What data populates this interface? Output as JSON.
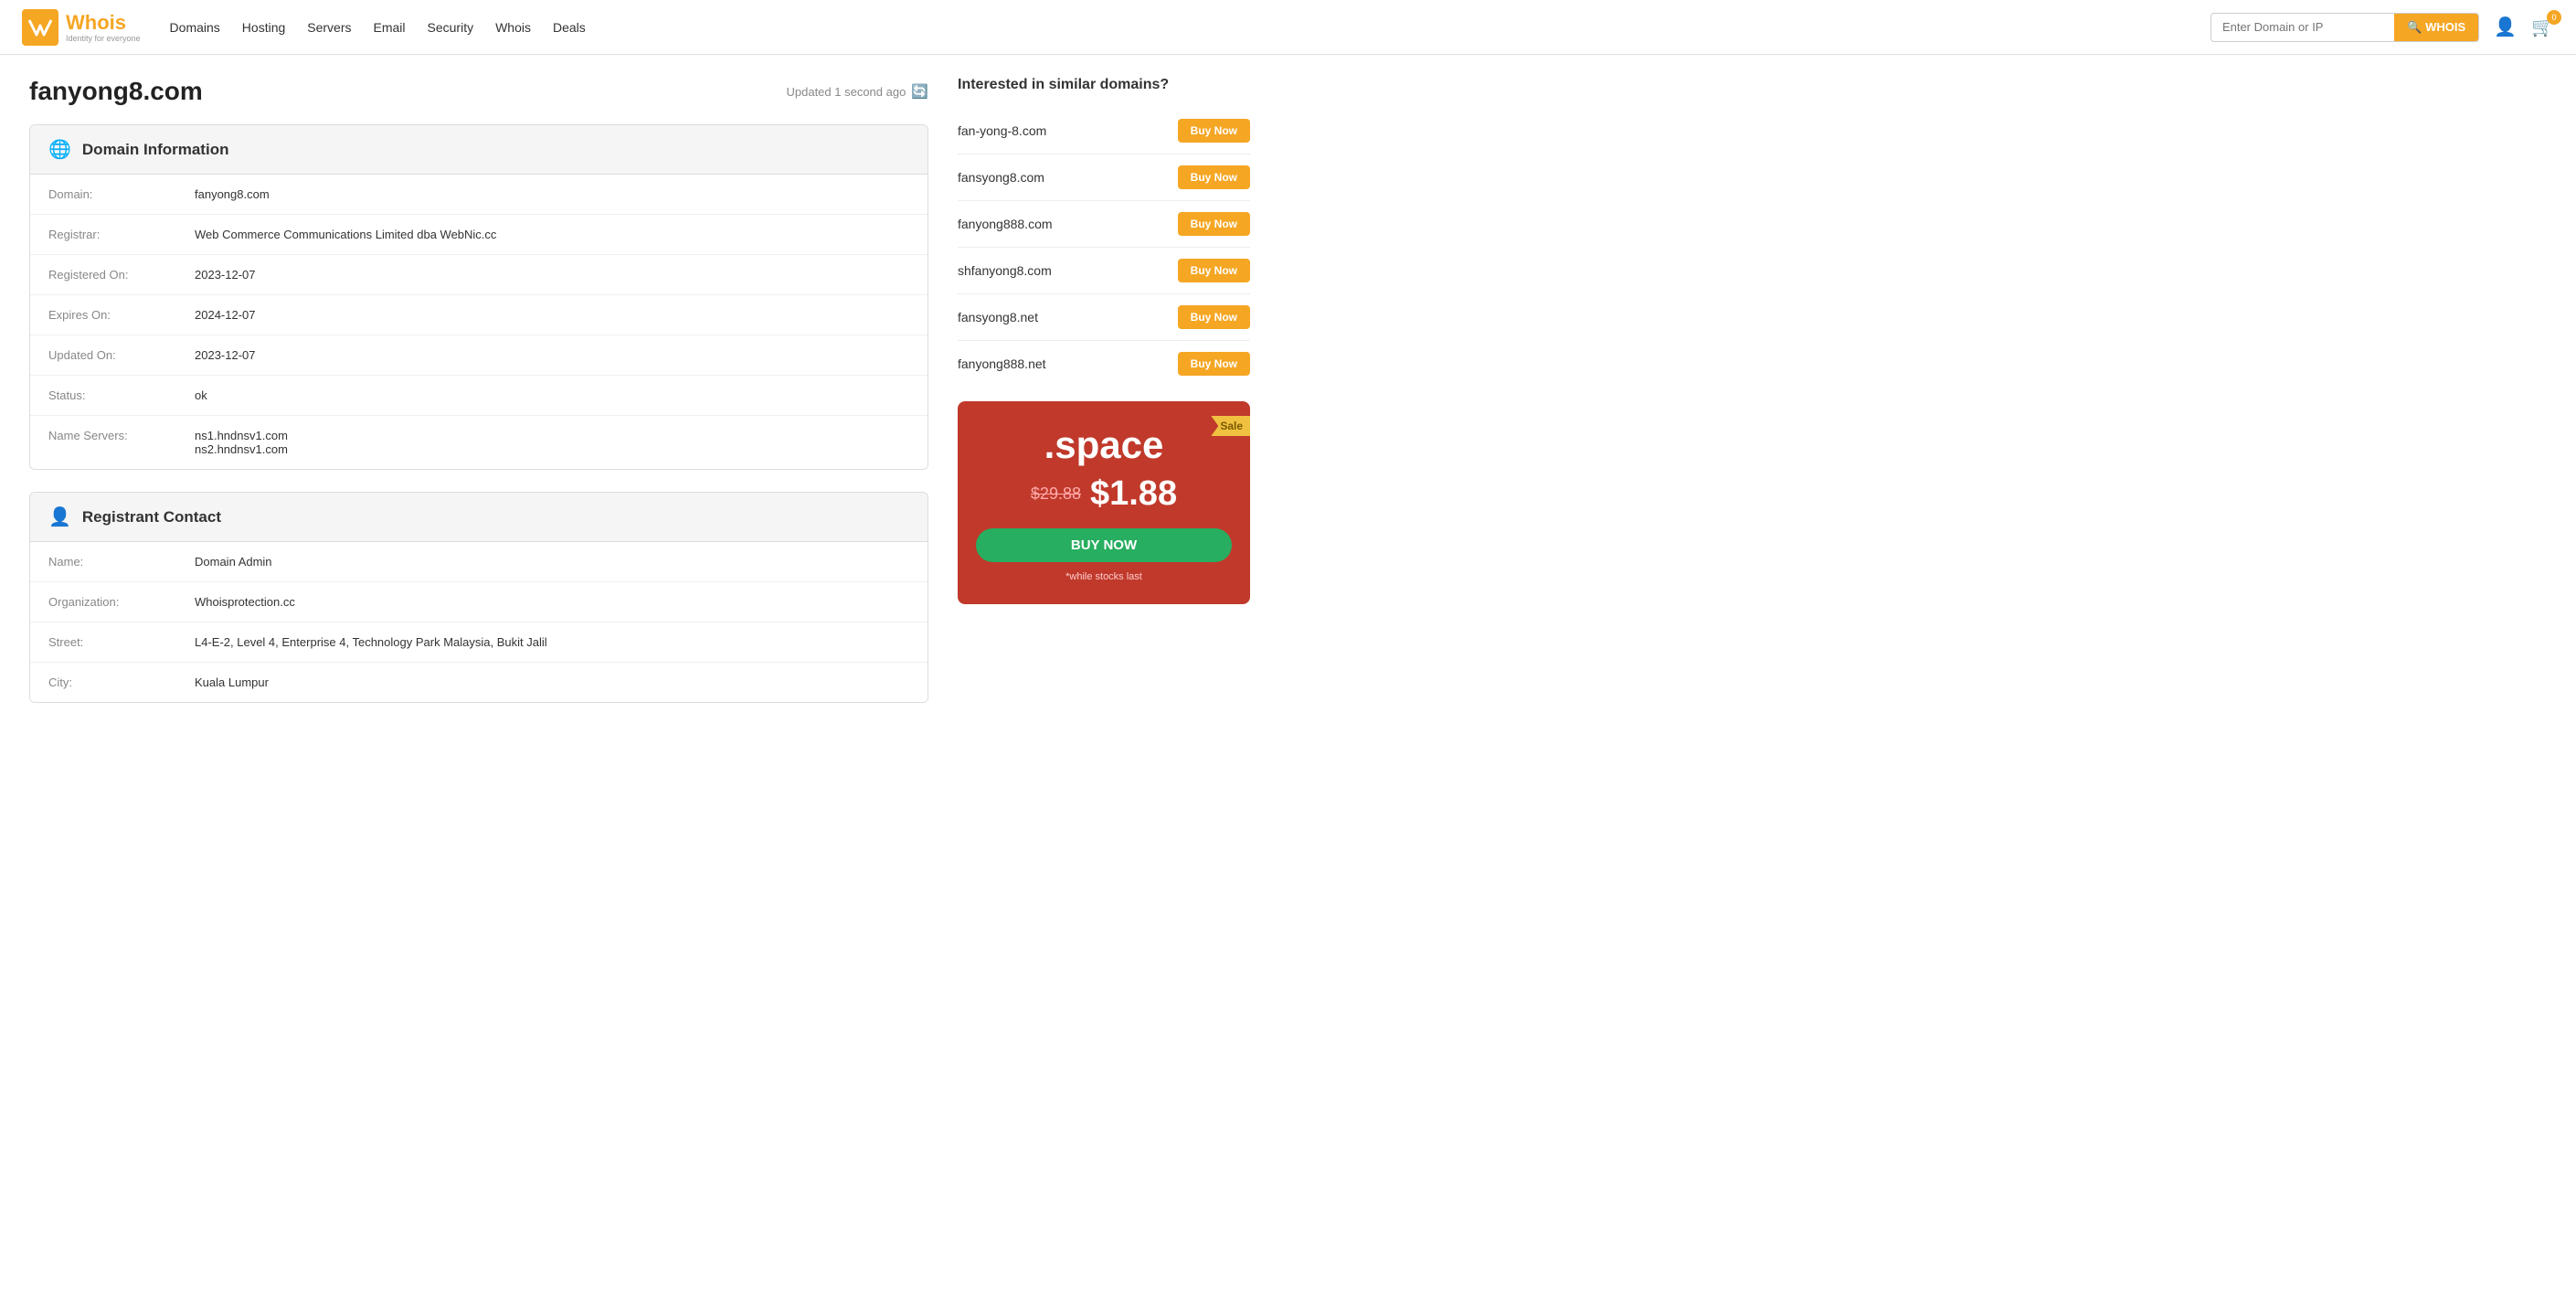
{
  "brand": {
    "name": "Whois",
    "tagline": "Identity for everyone"
  },
  "nav": {
    "links": [
      "Domains",
      "Hosting",
      "Servers",
      "Email",
      "Security",
      "Whois",
      "Deals"
    ],
    "search_placeholder": "Enter Domain or IP",
    "search_btn_label": "WHOIS"
  },
  "cart": {
    "count": "0"
  },
  "page": {
    "domain": "fanyong8.com",
    "updated_label": "Updated 1 second ago"
  },
  "domain_info": {
    "section_title": "Domain Information",
    "fields": [
      {
        "label": "Domain:",
        "value": "fanyong8.com"
      },
      {
        "label": "Registrar:",
        "value": "Web Commerce Communications Limited dba WebNic.cc"
      },
      {
        "label": "Registered On:",
        "value": "2023-12-07"
      },
      {
        "label": "Expires On:",
        "value": "2024-12-07"
      },
      {
        "label": "Updated On:",
        "value": "2023-12-07"
      },
      {
        "label": "Status:",
        "value": "ok"
      },
      {
        "label": "Name Servers:",
        "value": "ns1.hndnsv1.com\nns2.hndnsv1.com"
      }
    ]
  },
  "registrant": {
    "section_title": "Registrant Contact",
    "fields": [
      {
        "label": "Name:",
        "value": "Domain Admin"
      },
      {
        "label": "Organization:",
        "value": "Whoisprotection.cc"
      },
      {
        "label": "Street:",
        "value": "L4-E-2, Level 4, Enterprise 4, Technology Park Malaysia, Bukit Jalil"
      },
      {
        "label": "City:",
        "value": "Kuala Lumpur"
      }
    ]
  },
  "sidebar": {
    "similar_heading": "Interested in similar domains?",
    "domains": [
      {
        "name": "fan-yong-8.com"
      },
      {
        "name": "fansyong8.com"
      },
      {
        "name": "fanyong888.com"
      },
      {
        "name": "shfanyong8.com"
      },
      {
        "name": "fansyong8.net"
      },
      {
        "name": "fanyong888.net"
      }
    ],
    "buy_btn_label": "Buy Now",
    "promo": {
      "sale_badge": "Sale",
      "tld": ".space",
      "old_price": "$29.88",
      "new_price": "$1.88",
      "buy_btn": "BUY NOW",
      "fine_print": "*while stocks last"
    }
  }
}
